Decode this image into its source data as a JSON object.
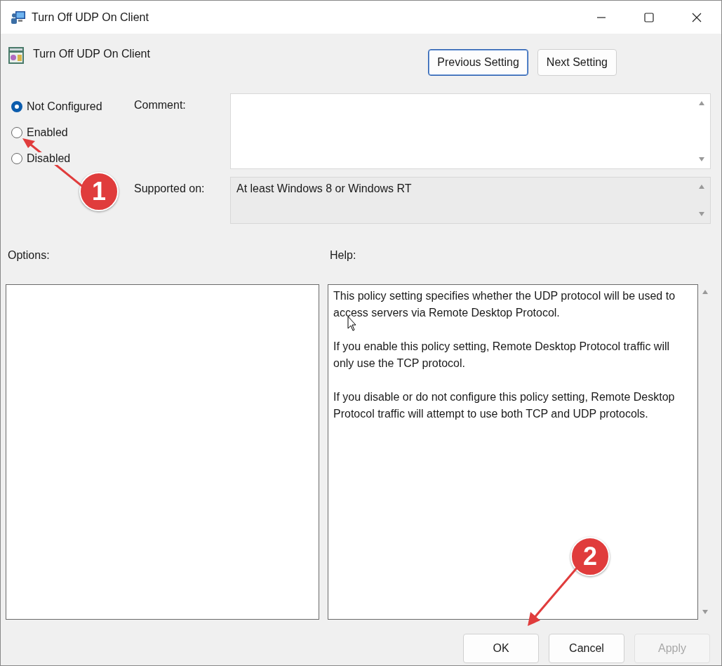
{
  "window": {
    "title": "Turn Off UDP On Client"
  },
  "header": {
    "title": "Turn Off UDP On Client"
  },
  "nav_buttons": [
    {
      "label": "Previous Setting",
      "focused": true
    },
    {
      "label": "Next Setting",
      "focused": false
    }
  ],
  "radios": [
    {
      "label": "Not Configured",
      "selected": true
    },
    {
      "label": "Enabled",
      "selected": false
    },
    {
      "label": "Disabled",
      "selected": false
    }
  ],
  "comment": {
    "label": "Comment:"
  },
  "supported_on": {
    "label": "Supported on:",
    "value": "At least Windows 8 or Windows RT"
  },
  "options": {
    "label": "Options:"
  },
  "help": {
    "label": "Help:",
    "paragraphs": [
      "This policy setting specifies whether the UDP protocol will be used to access servers via Remote Desktop Protocol.",
      "If you enable this policy setting, Remote Desktop Protocol traffic will only use the TCP protocol.",
      "If you disable or do not configure this policy setting, Remote Desktop Protocol traffic will attempt to use both TCP and UDP protocols."
    ]
  },
  "buttons": [
    {
      "label": "OK",
      "disabled": false
    },
    {
      "label": "Cancel",
      "disabled": false
    },
    {
      "label": "Apply",
      "disabled": true
    }
  ],
  "callouts": [
    {
      "number": "1"
    },
    {
      "number": "2"
    }
  ]
}
